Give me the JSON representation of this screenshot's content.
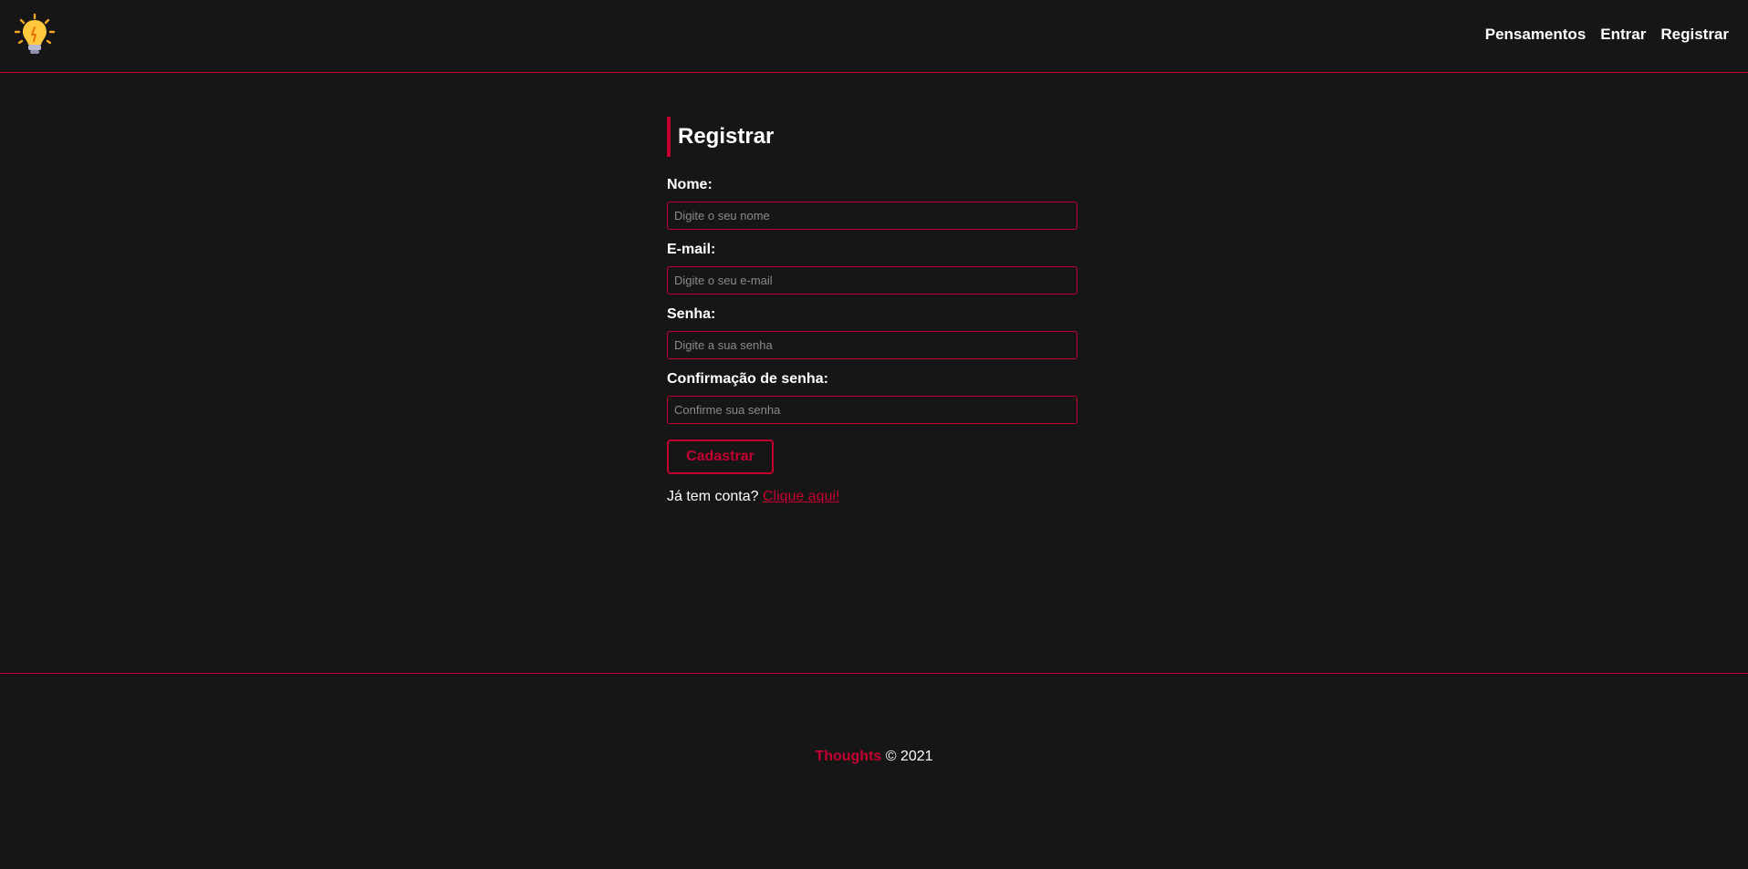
{
  "header": {
    "logo_icon": "lightbulb-icon",
    "nav": [
      {
        "label": "Pensamentos"
      },
      {
        "label": "Entrar"
      },
      {
        "label": "Registrar"
      }
    ]
  },
  "form": {
    "title": "Registrar",
    "fields": [
      {
        "label": "Nome:",
        "placeholder": "Digite o seu nome",
        "value": ""
      },
      {
        "label": "E-mail:",
        "placeholder": "Digite o seu e-mail",
        "value": ""
      },
      {
        "label": "Senha:",
        "placeholder": "Digite a sua senha",
        "value": ""
      },
      {
        "label": "Confirmação de senha:",
        "placeholder": "Confirme sua senha",
        "value": ""
      }
    ],
    "submit_label": "Cadastrar",
    "login_prompt": "Já tem conta?",
    "login_link": "Clique aqui!"
  },
  "footer": {
    "brand": "Thoughts",
    "copyright": "© 2021"
  },
  "colors": {
    "background": "#161617",
    "accent": "#c3002f",
    "text": "#ffffff"
  }
}
